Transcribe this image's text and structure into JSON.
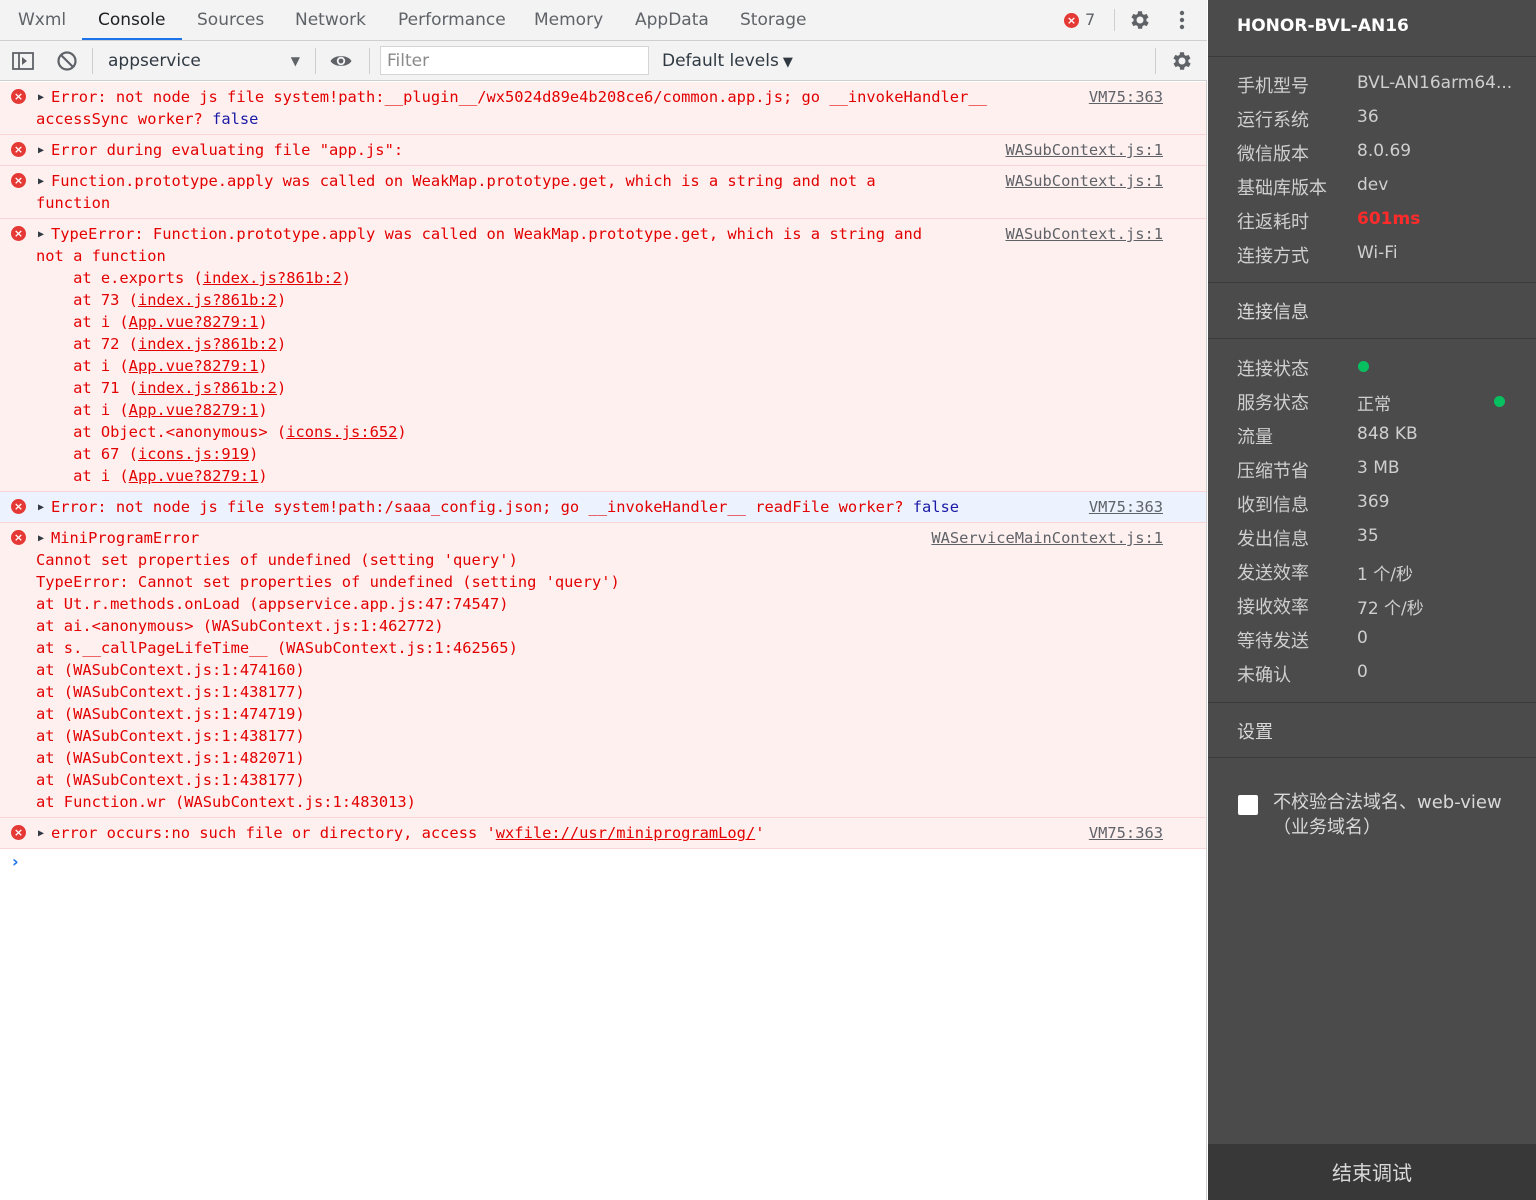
{
  "tabs": [
    "Wxml",
    "Console",
    "Sources",
    "Network",
    "Performance",
    "Memory",
    "AppData",
    "Storage"
  ],
  "active_tab": "Console",
  "error_badge": {
    "icon": "error-icon",
    "count": "7"
  },
  "toolbar": {
    "context": "appservice",
    "filter_placeholder": "Filter",
    "levels": "Default levels"
  },
  "messages": [
    {
      "lines": [
        "Error: not node js file system!path:__plugin__/wx5024d89e4b208ce6/common.app.js; go __invokeHandler__",
        "accessSync worker? "
      ],
      "trail": "false",
      "source": "VM75:363"
    },
    {
      "lines": [
        "Error during evaluating file \"app.js\":"
      ],
      "source": "WASubContext.js:1"
    },
    {
      "lines": [
        "Function.prototype.apply was called on WeakMap.prototype.get, which is a string and not a",
        "function"
      ],
      "source": "WASubContext.js:1"
    },
    {
      "lines": [
        "TypeError: Function.prototype.apply was called on WeakMap.prototype.get, which is a string and",
        "not a function"
      ],
      "source": "WASubContext.js:1",
      "stack": [
        {
          "pre": "    at e.exports (",
          "link": "index.js?861b:2",
          "post": ")"
        },
        {
          "pre": "    at 73 (",
          "link": "index.js?861b:2",
          "post": ")"
        },
        {
          "pre": "    at i (",
          "link": "App.vue?8279:1",
          "post": ")"
        },
        {
          "pre": "    at 72 (",
          "link": "index.js?861b:2",
          "post": ")"
        },
        {
          "pre": "    at i (",
          "link": "App.vue?8279:1",
          "post": ")"
        },
        {
          "pre": "    at 71 (",
          "link": "index.js?861b:2",
          "post": ")"
        },
        {
          "pre": "    at i (",
          "link": "App.vue?8279:1",
          "post": ")"
        },
        {
          "pre": "    at Object.<anonymous> (",
          "link": "icons.js:652",
          "post": ")"
        },
        {
          "pre": "    at 67 (",
          "link": "icons.js:919",
          "post": ")"
        },
        {
          "pre": "    at i (",
          "link": "App.vue?8279:1",
          "post": ")"
        }
      ]
    },
    {
      "lines": [
        "Error: not node js file system!path:/saaa_config.json; go __invokeHandler__ readFile worker? "
      ],
      "trail": "false",
      "source": "VM75:363"
    },
    {
      "lines": [
        "MiniProgramError"
      ],
      "source": "WAServiceMainContext.js:1",
      "body": [
        "Cannot set properties of undefined (setting 'query')",
        "TypeError: Cannot set properties of undefined (setting 'query')",
        "at Ut.r.methods.onLoad (appservice.app.js:47:74547)",
        "at ai.<anonymous> (WASubContext.js:1:462772)",
        "at s.__callPageLifeTime__ (WASubContext.js:1:462565)",
        "at (WASubContext.js:1:474160)",
        "at (WASubContext.js:1:438177)",
        "at (WASubContext.js:1:474719)",
        "at (WASubContext.js:1:438177)",
        "at (WASubContext.js:1:482071)",
        "at (WASubContext.js:1:438177)",
        "at Function.wr (WASubContext.js:1:483013)"
      ]
    },
    {
      "lines": [
        "error occurs:no such file or directory, access '"
      ],
      "link": "wxfile://usr/miniprogramLog/",
      "tail": "'",
      "source": "VM75:363"
    }
  ],
  "prompt": "›",
  "panel": {
    "device": "HONOR-BVL-AN16",
    "device_info": [
      {
        "label": "手机型号",
        "value": "BVL-AN16arm64..."
      },
      {
        "label": "运行系统",
        "value": "36"
      },
      {
        "label": "微信版本",
        "value": "8.0.69"
      },
      {
        "label": "基础库版本",
        "value": "dev"
      },
      {
        "label": "往返耗时",
        "value": "601ms"
      },
      {
        "label": "连接方式",
        "value": "Wi-Fi"
      }
    ],
    "conn_header": "连接信息",
    "conn_info": [
      {
        "label": "连接状态",
        "value": ""
      },
      {
        "label": "服务状态",
        "value": "正常"
      },
      {
        "label": "流量",
        "value": "848 KB"
      },
      {
        "label": "压缩节省",
        "value": "3 MB"
      },
      {
        "label": "收到信息",
        "value": "369"
      },
      {
        "label": "发出信息",
        "value": "35"
      },
      {
        "label": "发送效率",
        "value": "1 个/秒"
      },
      {
        "label": "接收效率",
        "value": "72 个/秒"
      },
      {
        "label": "等待发送",
        "value": "0"
      },
      {
        "label": "未确认",
        "value": "0"
      }
    ],
    "settings_header": "设置",
    "checkbox_label": "不校验合法域名、web-view（业务域名）",
    "end_button": "结束调试",
    "status_color": "#07c160",
    "latency_color": "#ff2a2a"
  }
}
